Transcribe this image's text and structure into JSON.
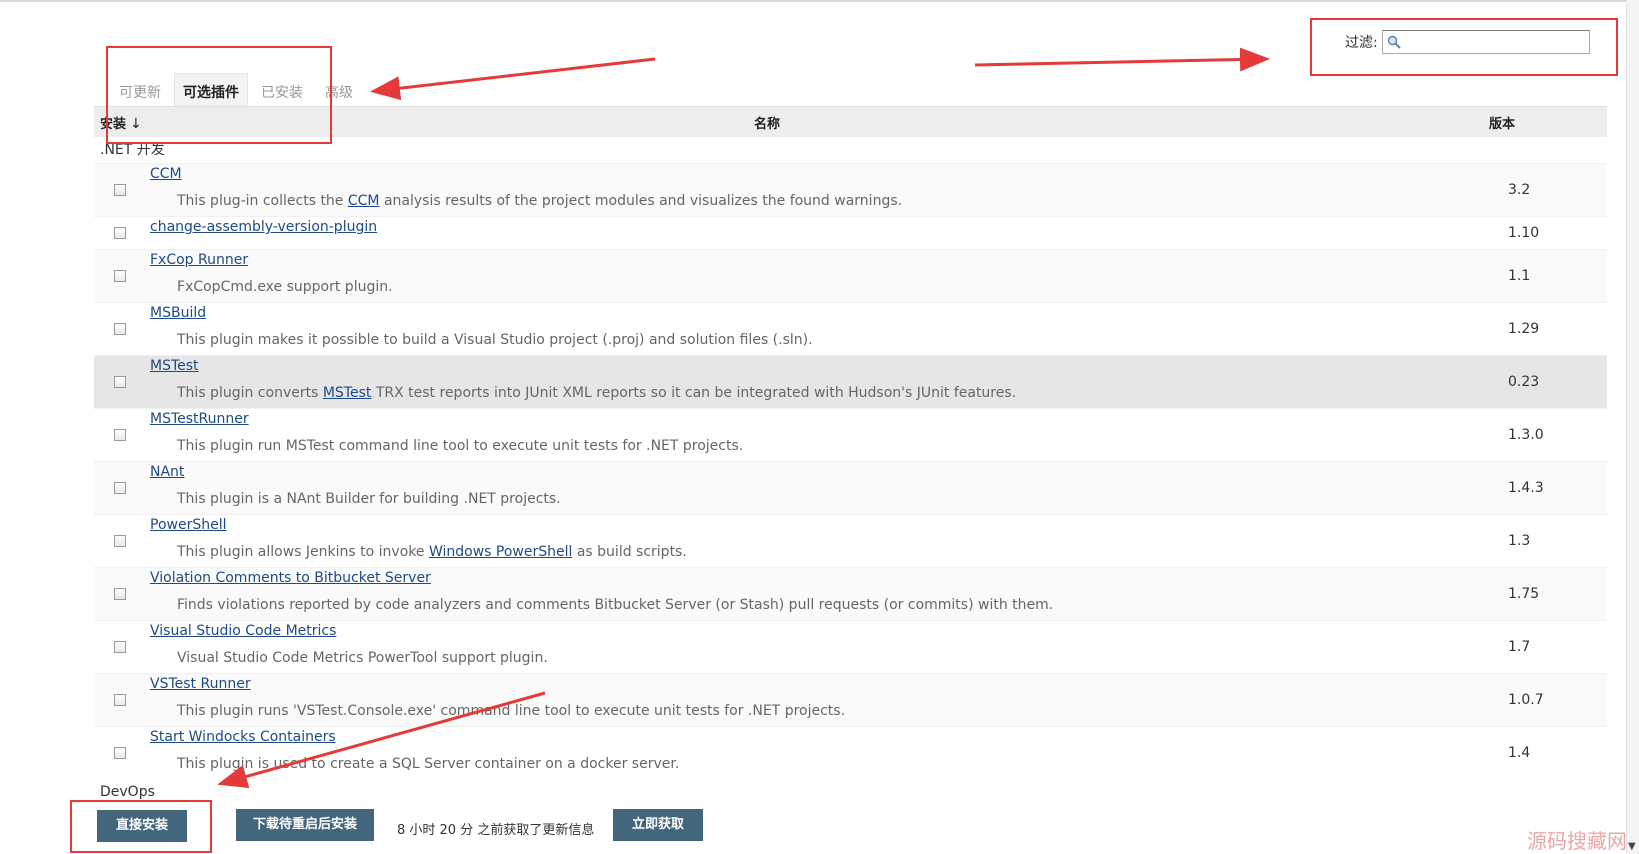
{
  "filter": {
    "label": "过滤:",
    "placeholder": "",
    "icon": "search-icon"
  },
  "tabs": [
    {
      "label": "可更新",
      "active": false
    },
    {
      "label": "可选插件",
      "active": true
    },
    {
      "label": "已安装",
      "active": false
    },
    {
      "label": "高级",
      "active": false
    }
  ],
  "table": {
    "headers": {
      "install": "安装",
      "sort_indicator": "↓",
      "name": "名称",
      "version": "版本"
    },
    "categories": [
      ".NET 开发",
      "DevOps"
    ],
    "plugins": [
      {
        "name": "CCM",
        "desc_parts": [
          "This plug-in collects the ",
          "CCM",
          " analysis results of the project modules and visualizes the found warnings."
        ],
        "version": "3.2"
      },
      {
        "name": "change-assembly-version-plugin",
        "desc_parts": [
          "",
          "",
          ""
        ],
        "version": "1.10"
      },
      {
        "name": "FxCop Runner",
        "desc_parts": [
          "FxCopCmd.exe support plugin.",
          "",
          ""
        ],
        "version": "1.1"
      },
      {
        "name": "MSBuild",
        "desc_parts": [
          "This plugin makes it possible to build a Visual Studio project (.proj) and solution files (.sln).",
          "",
          ""
        ],
        "version": "1.29"
      },
      {
        "name": "MSTest",
        "desc_parts": [
          "This plugin converts ",
          "MSTest",
          " TRX test reports into JUnit XML reports so it can be integrated with Hudson's JUnit features."
        ],
        "version": "0.23"
      },
      {
        "name": "MSTestRunner",
        "desc_parts": [
          "This plugin run MSTest command line tool to execute unit tests for .NET projects.",
          "",
          ""
        ],
        "version": "1.3.0"
      },
      {
        "name": "NAnt",
        "desc_parts": [
          "This plugin is a NAnt Builder for building .NET projects.",
          "",
          ""
        ],
        "version": "1.4.3"
      },
      {
        "name": "PowerShell",
        "desc_parts": [
          "This plugin allows Jenkins to invoke ",
          "Windows PowerShell",
          " as build scripts."
        ],
        "version": "1.3"
      },
      {
        "name": "Violation Comments to Bitbucket Server",
        "desc_parts": [
          "Finds violations reported by code analyzers and comments Bitbucket Server (or Stash) pull requests (or commits) with them.",
          "",
          ""
        ],
        "version": "1.75"
      },
      {
        "name": "Visual Studio Code Metrics",
        "desc_parts": [
          "Visual Studio Code Metrics PowerTool support plugin.",
          "",
          ""
        ],
        "version": "1.7"
      },
      {
        "name": "VSTest Runner",
        "desc_parts": [
          "This plugin runs 'VSTest.Console.exe' command line tool to execute unit tests for .NET projects.",
          "",
          ""
        ],
        "version": "1.0.7"
      },
      {
        "name": "Start Windocks Containers",
        "desc_parts": [
          "This plugin is used to create a SQL Server container on a docker server.",
          "",
          ""
        ],
        "version": "1.4"
      }
    ]
  },
  "bottom": {
    "install_label": "直接安装",
    "download_label": "下载待重启后安装",
    "update_info": "8 小时 20 分 之前获取了更新信息",
    "check_label": "立即获取"
  },
  "watermark": "源码搜藏网",
  "colors": {
    "button": "#44667d",
    "link": "#204a87",
    "annotation": "#e53a3a"
  }
}
